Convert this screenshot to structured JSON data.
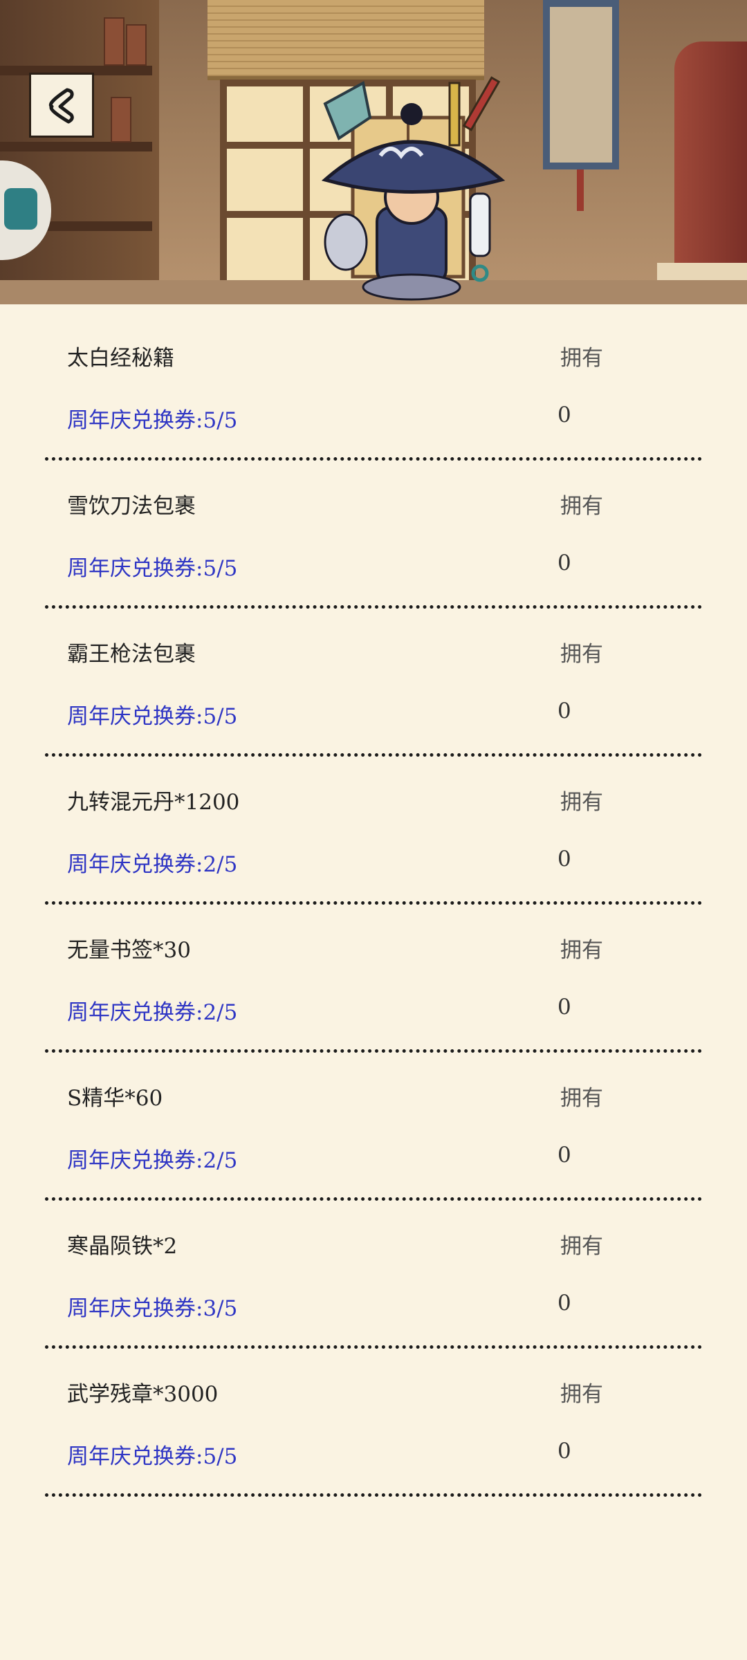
{
  "nav": {
    "back_icon": "chevron-left-icon"
  },
  "colors": {
    "background": "#faf3e2",
    "cost_text": "#2e35c4"
  },
  "items": [
    {
      "name": "太白经秘籍",
      "own_label": "拥有",
      "cost": "周年庆兑换券:5/5",
      "owned": "0"
    },
    {
      "name": "雪饮刀法包裹",
      "own_label": "拥有",
      "cost": "周年庆兑换券:5/5",
      "owned": "0"
    },
    {
      "name": "霸王枪法包裹",
      "own_label": "拥有",
      "cost": "周年庆兑换券:5/5",
      "owned": "0"
    },
    {
      "name": "九转混元丹*1200",
      "own_label": "拥有",
      "cost": "周年庆兑换券:2/5",
      "owned": "0"
    },
    {
      "name": "无量书签*30",
      "own_label": "拥有",
      "cost": "周年庆兑换券:2/5",
      "owned": "0"
    },
    {
      "name": "S精华*60",
      "own_label": "拥有",
      "cost": "周年庆兑换券:2/5",
      "owned": "0"
    },
    {
      "name": "寒晶陨铁*2",
      "own_label": "拥有",
      "cost": "周年庆兑换券:3/5",
      "owned": "0"
    },
    {
      "name": "武学残章*3000",
      "own_label": "拥有",
      "cost": "周年庆兑换券:5/5",
      "owned": "0"
    }
  ]
}
